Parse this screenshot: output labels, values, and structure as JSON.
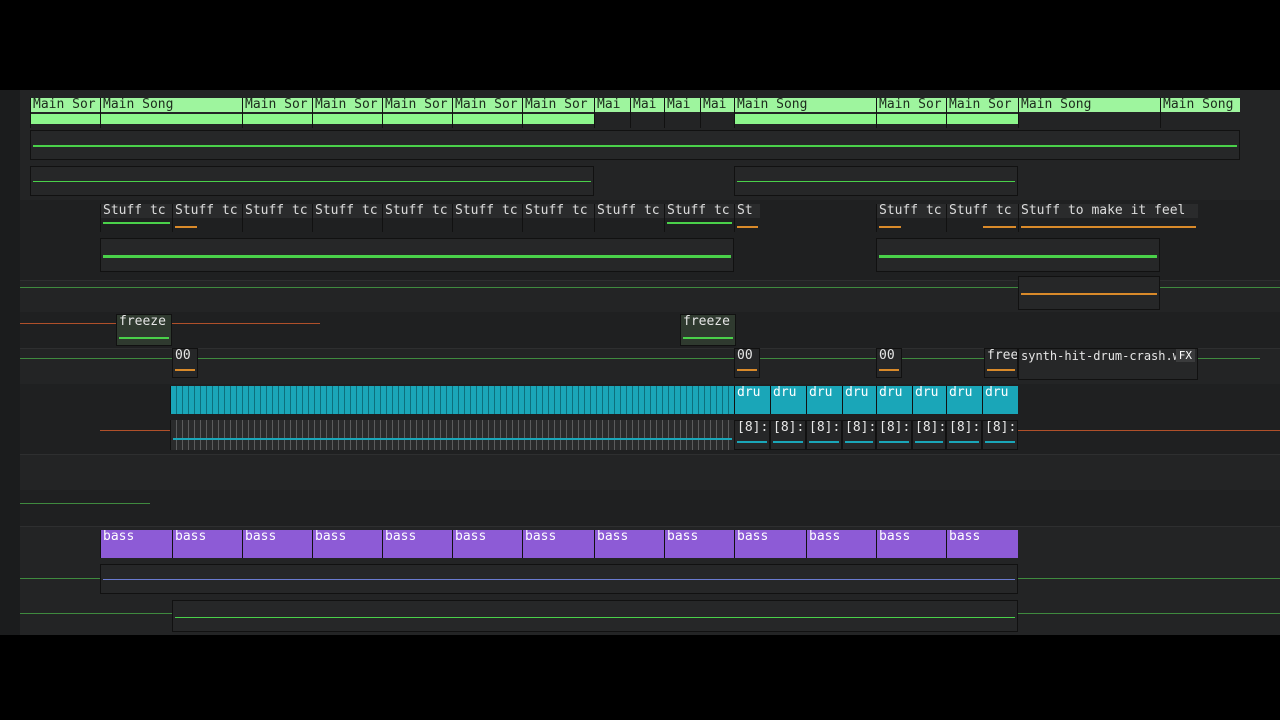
{
  "song_clips": {
    "labels": [
      "Main Sor",
      "Main Song",
      "Main Sor",
      "Main Sor",
      "Main Sor",
      "Main Sor",
      "Main Sor",
      "Mai",
      "Mai",
      "Mai",
      "Mai",
      "Main Song",
      "Main Sor",
      "Main Sor",
      "Main Song",
      "Main Song"
    ]
  },
  "stuff_clips": {
    "labels": [
      "Stuff tc",
      "Stuff tc",
      "Stuff tc",
      "Stuff tc",
      "Stuff tc",
      "Stuff tc",
      "Stuff tc",
      "Stuff tc",
      "Stuff tc",
      "St",
      "Stuff tc",
      "Stuff tc",
      "Stuff to make it feel"
    ]
  },
  "freeze_clips": {
    "labels": [
      "freeze",
      "freeze",
      "free"
    ]
  },
  "marker_clips": {
    "labels": [
      "00",
      "00",
      "00"
    ]
  },
  "crash_clip": {
    "label": "synth-hit-drum-crash.w",
    "fx_label": "FX"
  },
  "drum_clips": {
    "labels": [
      "dru",
      "dru",
      "dru",
      "dru",
      "dru",
      "dru",
      "dru",
      "dru"
    ],
    "sub_labels": [
      "[8]:",
      "[8]:",
      "[8]:",
      "[8]:",
      "[8]:",
      "[8]:",
      "[8]:",
      "[8]:"
    ]
  },
  "bass_clips": {
    "labels": [
      "bass",
      "bass",
      "bass",
      "bass",
      "bass",
      "bass",
      "bass",
      "bass",
      "bass",
      "bass",
      "bass",
      "bass",
      "bass"
    ]
  },
  "colors": {
    "song": "#9ef59e",
    "bass": "#8d5bd6",
    "drum": "#1aa6b8",
    "green": "#4ad14a",
    "orange": "#d98a2a"
  }
}
